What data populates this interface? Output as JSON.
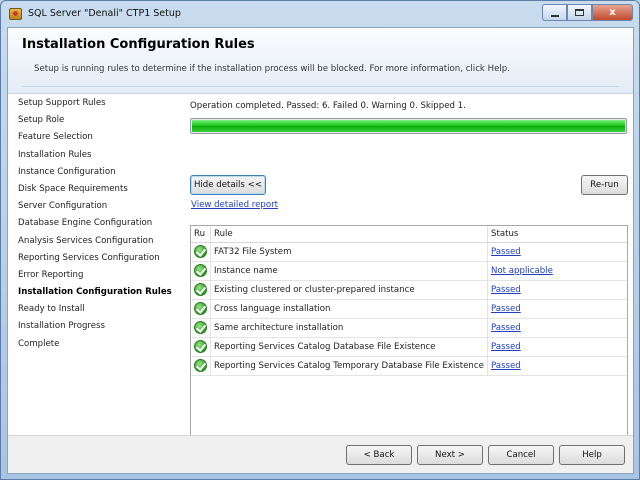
{
  "window": {
    "title": "SQL Server \"Denali\" CTP1 Setup",
    "close_glyph": "x"
  },
  "header": {
    "title": "Installation Configuration Rules",
    "description": "Setup is running rules to determine if the installation process will be blocked. For more information, click Help."
  },
  "nav": {
    "items": [
      {
        "label": "Setup Support Rules",
        "active": false
      },
      {
        "label": "Setup Role",
        "active": false
      },
      {
        "label": "Feature Selection",
        "active": false
      },
      {
        "label": "Installation Rules",
        "active": false
      },
      {
        "label": "Instance Configuration",
        "active": false
      },
      {
        "label": "Disk Space Requirements",
        "active": false
      },
      {
        "label": "Server Configuration",
        "active": false
      },
      {
        "label": "Database Engine Configuration",
        "active": false
      },
      {
        "label": "Analysis Services Configuration",
        "active": false
      },
      {
        "label": "Reporting Services Configuration",
        "active": false
      },
      {
        "label": "Error Reporting",
        "active": false
      },
      {
        "label": "Installation Configuration Rules",
        "active": true
      },
      {
        "label": "Ready to Install",
        "active": false
      },
      {
        "label": "Installation Progress",
        "active": false
      },
      {
        "label": "Complete",
        "active": false
      }
    ]
  },
  "main": {
    "status_text": "Operation completed. Passed: 6.   Failed 0.   Warning 0.   Skipped 1.",
    "progress": 1.0,
    "hide_details_label": "Hide details <<",
    "rerun_label": "Re-run",
    "view_report_label": "View detailed report",
    "table": {
      "headers": {
        "ru": "Ru",
        "rule": "Rule",
        "status": "Status"
      },
      "rows": [
        {
          "rule": "FAT32 File System",
          "status": "Passed"
        },
        {
          "rule": "Instance name",
          "status": "Not applicable"
        },
        {
          "rule": "Existing clustered or cluster-prepared instance",
          "status": "Passed"
        },
        {
          "rule": "Cross language installation",
          "status": "Passed"
        },
        {
          "rule": "Same architecture installation",
          "status": "Passed"
        },
        {
          "rule": "Reporting Services Catalog Database File Existence",
          "status": "Passed"
        },
        {
          "rule": "Reporting Services Catalog Temporary Database File Existence",
          "status": "Passed"
        }
      ]
    }
  },
  "footer": {
    "back_label": "< Back",
    "next_label": "Next >",
    "cancel_label": "Cancel",
    "help_label": "Help"
  },
  "icons": {
    "app": "sql-setup-icon",
    "row_status": "green-check-icon"
  }
}
